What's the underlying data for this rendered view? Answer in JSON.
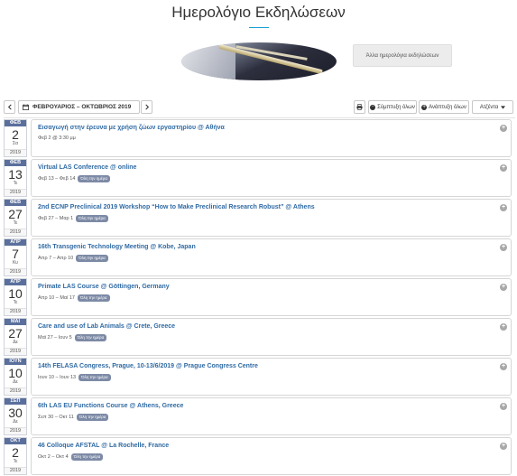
{
  "page_title": "Ημερολόγιο Εκδηλώσεων",
  "other_calendars_label": "Άλλα ημερολόγια εκδηλώσεων",
  "toolbar": {
    "prev_icon": "chevron-left",
    "next_icon": "chevron-right",
    "range_label": "ΦΕΒΡΟΥΑΡΙΟΣ – ΟΚΤΩΒΡΙΟΣ 2019",
    "print_icon": "printer",
    "collapse_all": "Σύμπτυξη όλων",
    "expand_all": "Ανάπτυξη όλων",
    "view_select": "Ατζέντα"
  },
  "all_day_badge": "Όλη την ημέρα",
  "events": [
    {
      "month": "ΦΕΒ",
      "day": "2",
      "weekday": "Σα",
      "year": "2019",
      "title": "Εισαγωγή στην έρευνα με χρήση ζώων εργαστηρίου @ Αθήνα",
      "when": "Φεβ 2 @ 3:30 μμ",
      "all_day": false
    },
    {
      "month": "ΦΕΒ",
      "day": "13",
      "weekday": "Τε",
      "year": "2019",
      "title": "Virtual LAS Conference @ online",
      "when": "Φεβ 13 – Φεβ 14",
      "all_day": true
    },
    {
      "month": "ΦΕΒ",
      "day": "27",
      "weekday": "Τε",
      "year": "2019",
      "title": "2nd ECNP Preclinical 2019 Workshop “How to Make Preclinical Research Robust” @ Athens",
      "when": "Φεβ 27 – Μαρ 1",
      "all_day": true
    },
    {
      "month": "ΑΠΡ",
      "day": "7",
      "weekday": "Κυ",
      "year": "2019",
      "title": "16th Transgenic Technology Meeting @ Kobe, Japan",
      "when": "Απρ 7 – Απρ 10",
      "all_day": true
    },
    {
      "month": "ΑΠΡ",
      "day": "10",
      "weekday": "Τε",
      "year": "2019",
      "title": "Primate LAS Course @ Göttingen, Germany",
      "when": "Απρ 10 – Μαϊ 17",
      "all_day": true
    },
    {
      "month": "ΜΑΙ",
      "day": "27",
      "weekday": "Δε",
      "year": "2019",
      "title": "Care and use of Lab Animals @ Crete, Greece",
      "when": "Μαϊ 27 – Ιουν 5",
      "all_day": true
    },
    {
      "month": "ΙΟΥΝ",
      "day": "10",
      "weekday": "Δε",
      "year": "2019",
      "title": "14th FELASA Congress, Prague, 10-13/6/2019 @ Prague Congress Centre",
      "when": "Ιουν 10 – Ιουν 13",
      "all_day": true
    },
    {
      "month": "ΣΕΠ",
      "day": "30",
      "weekday": "Δε",
      "year": "2019",
      "title": "6th LAS EU Functions Course @ Athens, Greece",
      "when": "Σεπ 30 – Οκτ 11",
      "all_day": true
    },
    {
      "month": "ΟΚΤ",
      "day": "2",
      "weekday": "Τε",
      "year": "2019",
      "title": "46 Colloque AFSTAL @ La Rochelle, France",
      "when": "Οκτ 2 – Οκτ 4",
      "all_day": true
    }
  ]
}
